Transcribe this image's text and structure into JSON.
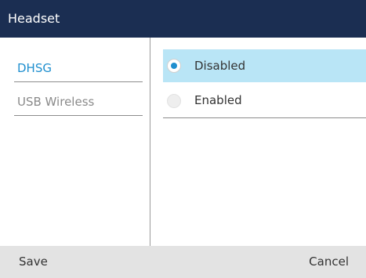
{
  "header": {
    "title": "Headset"
  },
  "left_menu": {
    "items": [
      {
        "label": "DHSG",
        "selected": true
      },
      {
        "label": "USB Wireless",
        "selected": false
      }
    ]
  },
  "options": {
    "items": [
      {
        "label": "Disabled",
        "checked": true
      },
      {
        "label": "Enabled",
        "checked": false
      }
    ]
  },
  "softkeys": {
    "left_label": "Save",
    "right_label": "Cancel"
  },
  "colors": {
    "title_bar": "#1b2e52",
    "accent": "#1f8fcf",
    "highlight_row": "#b9e5f6",
    "softkey_bar": "#e3e3e3"
  }
}
